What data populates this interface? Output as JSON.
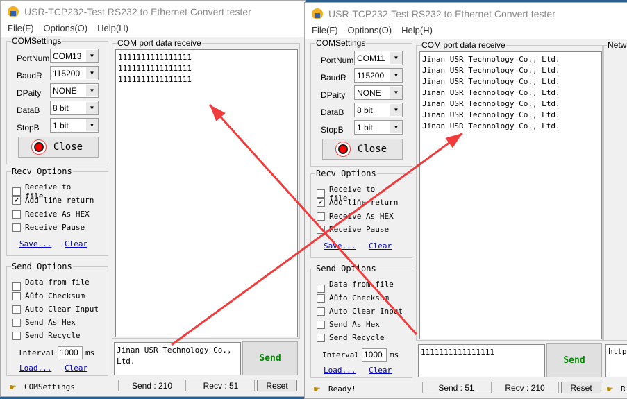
{
  "windows": [
    {
      "title": "USR-TCP232-Test  RS232 to Ethernet Convert tester",
      "menu": [
        "File(F)",
        "Options(O)",
        "Help(H)"
      ],
      "com_settings": {
        "label": "COMSettings",
        "port_label": "PortNum",
        "port": "COM13",
        "baud_label": "BaudR",
        "baud": "115200",
        "parity_label": "DPaity",
        "parity": "NONE",
        "databits_label": "DataB",
        "databits": "8 bit",
        "stopbits_label": "StopB",
        "stopbits": "1 bit",
        "close_label": "Close"
      },
      "recv_options": {
        "label": "Recv Options",
        "items": [
          {
            "label": "Receive to file...",
            "checked": false
          },
          {
            "label": "Add line return",
            "checked": true
          },
          {
            "label": "Receive As HEX",
            "checked": false
          },
          {
            "label": "Receive Pause",
            "checked": false
          }
        ],
        "save": "Save...",
        "clear": "Clear"
      },
      "send_options": {
        "label": "Send Options",
        "items": [
          {
            "label": "Data from file ...",
            "checked": false
          },
          {
            "label": "Auto Checksum",
            "checked": false
          },
          {
            "label": "Auto Clear Input",
            "checked": false
          },
          {
            "label": "Send As Hex",
            "checked": false
          },
          {
            "label": "Send Recycle",
            "checked": false
          }
        ],
        "interval_label": "Interval",
        "interval": "1000",
        "interval_unit": "ms",
        "load": "Load...",
        "clear": "Clear"
      },
      "receive": {
        "label": "COM port data receive",
        "text": "1111111111111111\n1111111111111111\n1111111111111111"
      },
      "send_input": "Jinan USR Technology Co., Ltd.",
      "send_button": "Send",
      "status": {
        "left": "COMSettings",
        "send": "Send : 210",
        "recv": "Recv : 51",
        "reset": "Reset"
      }
    },
    {
      "title": "USR-TCP232-Test  RS232 to Ethernet Convert tester",
      "menu": [
        "File(F)",
        "Options(O)",
        "Help(H)"
      ],
      "com_settings": {
        "label": "COMSettings",
        "port_label": "PortNum",
        "port": "COM11",
        "baud_label": "BaudR",
        "baud": "115200",
        "parity_label": "DPaity",
        "parity": "NONE",
        "databits_label": "DataB",
        "databits": "8 bit",
        "stopbits_label": "StopB",
        "stopbits": "1 bit",
        "close_label": "Close"
      },
      "recv_options": {
        "label": "Recv Options",
        "items": [
          {
            "label": "Receive to file...",
            "checked": false
          },
          {
            "label": "Add line return",
            "checked": true
          },
          {
            "label": "Receive As HEX",
            "checked": false
          },
          {
            "label": "Receive Pause",
            "checked": false
          }
        ],
        "save": "Save...",
        "clear": "Clear"
      },
      "send_options": {
        "label": "Send Options",
        "items": [
          {
            "label": "Data from file ...",
            "checked": false
          },
          {
            "label": "Auto Checksum",
            "checked": false
          },
          {
            "label": "Auto Clear Input",
            "checked": false
          },
          {
            "label": "Send As Hex",
            "checked": false
          },
          {
            "label": "Send Recycle",
            "checked": false
          }
        ],
        "interval_label": "Interval",
        "interval": "1000",
        "interval_unit": "ms",
        "load": "Load...",
        "clear": "Clear"
      },
      "receive": {
        "label": "COM port data receive",
        "text": "Jinan USR Technology Co., Ltd.\nJinan USR Technology Co., Ltd.\nJinan USR Technology Co., Ltd.\nJinan USR Technology Co., Ltd.\nJinan USR Technology Co., Ltd.\nJinan USR Technology Co., Ltd.\nJinan USR Technology Co., Ltd."
      },
      "send_input": "1111111111111111",
      "send_button": "Send",
      "status": {
        "left": "Ready!",
        "send": "Send : 51",
        "recv": "Recv : 210",
        "reset": "Reset"
      },
      "network": {
        "label": "Netw",
        "input": "http:",
        "status": "R"
      }
    }
  ],
  "annotation_color": "#f03c3c"
}
